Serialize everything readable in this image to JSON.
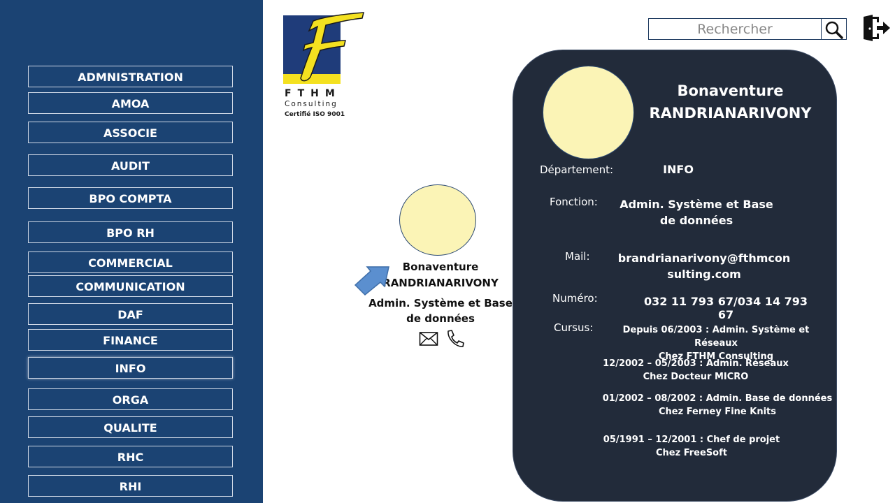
{
  "sidebar": {
    "items": [
      {
        "label": "ADMNISTRATION"
      },
      {
        "label": "AMOA"
      },
      {
        "label": "ASSOCIE"
      },
      {
        "label": "AUDIT"
      },
      {
        "label": "BPO COMPTA"
      },
      {
        "label": "BPO RH"
      },
      {
        "label": "COMMERCIAL"
      },
      {
        "label": "COMMUNICATION"
      },
      {
        "label": "DAF"
      },
      {
        "label": "FINANCE"
      },
      {
        "label": "INFO"
      },
      {
        "label": "ORGA"
      },
      {
        "label": "QUALITE"
      },
      {
        "label": "RHC"
      },
      {
        "label": "RHI"
      }
    ],
    "active": "INFO"
  },
  "logo": {
    "letters": "FTHM",
    "subtitle": "Consulting",
    "certification": "Certifié ISO 9001"
  },
  "search": {
    "placeholder": "Rechercher",
    "icon": "magnifier-icon"
  },
  "header": {
    "logout_icon": "logout-icon"
  },
  "mini_card": {
    "first_name": "Bonaventure",
    "last_name": "RANDRIANARIVONY",
    "role_line1": "Admin. Système et Base",
    "role_line2": "de données",
    "icons": [
      "mail-icon",
      "phone-icon"
    ]
  },
  "profile": {
    "first_name": "Bonaventure",
    "last_name": "RANDRIANARIVONY",
    "department_label": "Département:",
    "department": "INFO",
    "function_label": "Fonction:",
    "function_line1": "Admin. Système et Base",
    "function_line2": "de données",
    "mail_label": "Mail:",
    "mail_line1": "brandrianarivony@fthmcon",
    "mail_line2": "sulting.com",
    "number_label": "Numéro:",
    "number": "032 11 793 67/034 14 793 67",
    "cursus_label": "Cursus:",
    "cursus": [
      {
        "line1": "Depuis 06/2003 : Admin. Système et Réseaux",
        "line2": "Chez FTHM Consulting"
      },
      {
        "line1": "12/2002 – 05/2003 : Admin. Réseaux",
        "line2": "Chez Docteur MICRO"
      },
      {
        "line1": "01/2002 – 08/2002 : Admin. Base de données",
        "line2": "Chez Ferney Fine Knits"
      },
      {
        "line1": "05/1991 – 12/2001 : Chef de projet",
        "line2": "Chez FreeSoft"
      }
    ]
  },
  "colors": {
    "sidebar_bg": "#1b4373",
    "card_bg": "#222b3a",
    "avatar_fill": "#fbf4b6",
    "logo_blue": "#1f3c7a",
    "logo_yellow": "#f4e120",
    "arrow_blue": "#5b8fcf"
  }
}
